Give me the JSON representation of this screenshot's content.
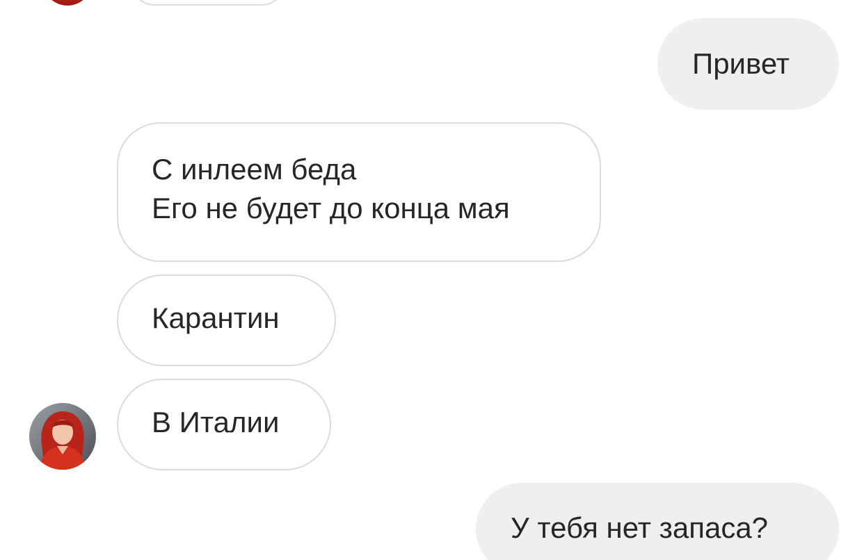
{
  "conversation": {
    "messages": [
      {
        "direction": "outgoing",
        "lines": [
          "Привет"
        ]
      },
      {
        "direction": "incoming",
        "lines": [
          "С инлеем беда",
          "Его не будет до конца мая"
        ]
      },
      {
        "direction": "incoming",
        "lines": [
          "Карантин"
        ]
      },
      {
        "direction": "incoming",
        "lines": [
          "В Италии"
        ]
      },
      {
        "direction": "outgoing",
        "lines": [
          "У тебя нет запаса?"
        ]
      }
    ],
    "contact": {
      "avatar_icon": "user-avatar-photo"
    }
  },
  "colors": {
    "background": "#ffffff",
    "incoming_bubble_bg": "#ffffff",
    "incoming_bubble_border": "#dbdbdb",
    "outgoing_bubble_bg": "#efefef",
    "text": "#262626"
  }
}
